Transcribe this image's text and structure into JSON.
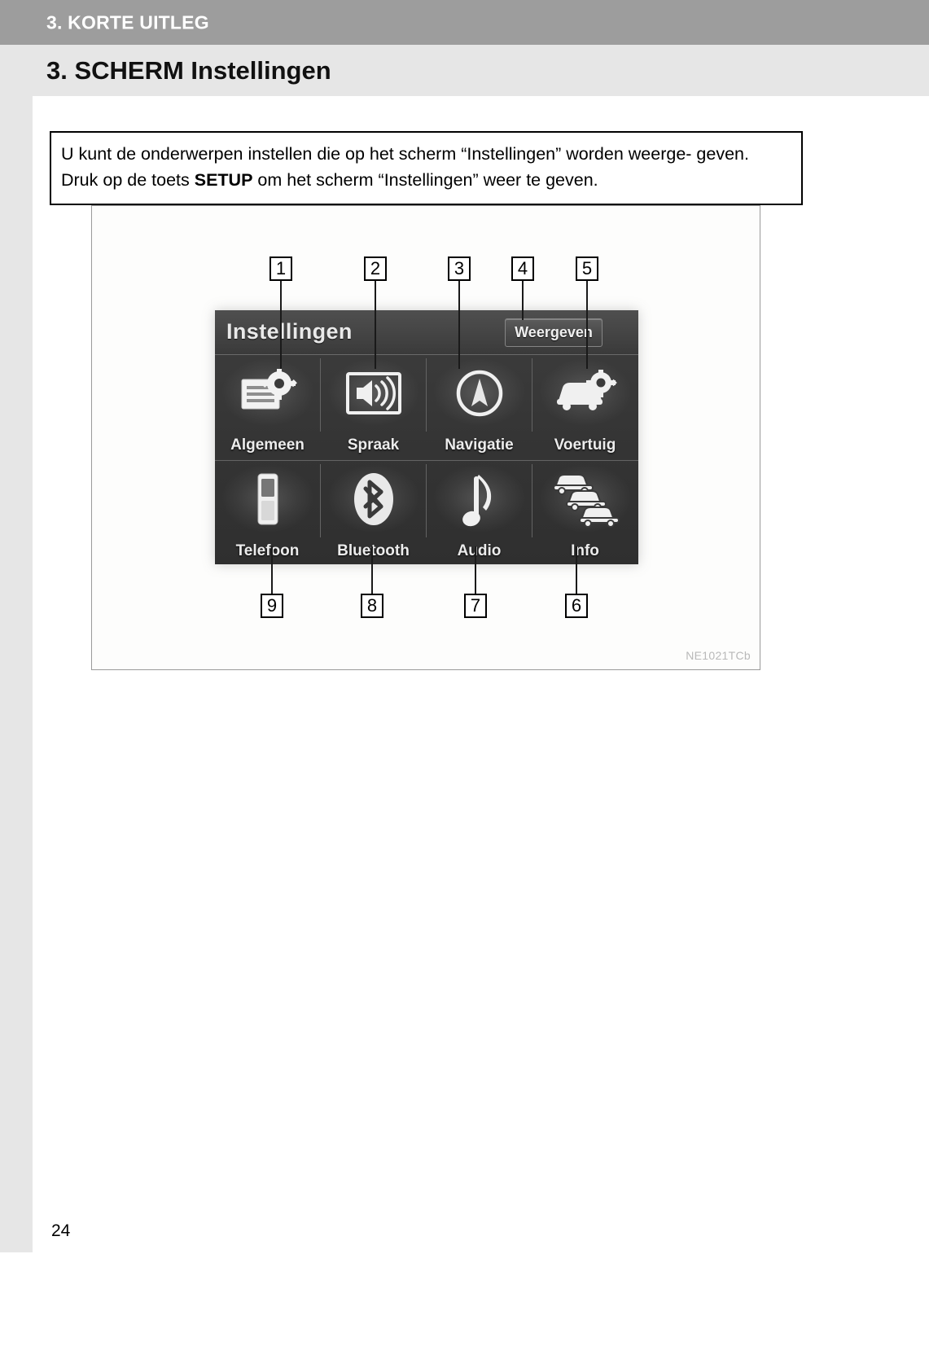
{
  "chapter": {
    "label": "3. KORTE UITLEG"
  },
  "section": {
    "title": "3. SCHERM Instellingen"
  },
  "intro": {
    "line1_before": "U kunt de onderwerpen instellen die op het scherm “Instellingen” worden weerge-",
    "line2_a": "geven. Druk op de toets ",
    "line2_key": "SETUP",
    "line2_b": " om het scherm “Instellingen” weer te geven."
  },
  "figure": {
    "code": "NE1021TCb",
    "screen": {
      "title": "Instellingen",
      "display_button": "Weergeven",
      "items": [
        {
          "label": "Algemeen",
          "icon": "general-settings-icon",
          "callout": "1"
        },
        {
          "label": "Spraak",
          "icon": "voice-speaker-icon",
          "callout": "2"
        },
        {
          "label": "Navigatie",
          "icon": "navigation-compass-icon",
          "callout": "3"
        },
        {
          "label": "Voertuig",
          "icon": "vehicle-settings-icon",
          "callout": "5"
        },
        {
          "label": "Telefoon",
          "icon": "phone-icon",
          "callout": "9"
        },
        {
          "label": "Bluetooth",
          "icon": "bluetooth-icon",
          "callout": "8"
        },
        {
          "label": "Audio",
          "icon": "music-note-icon",
          "callout": "7"
        },
        {
          "label": "Info",
          "icon": "traffic-cars-icon",
          "callout": "6"
        }
      ]
    },
    "callouts_top": [
      "1",
      "2",
      "3",
      "4",
      "5"
    ],
    "callouts_bottom": [
      "9",
      "8",
      "7",
      "6"
    ]
  },
  "page": {
    "number": "24"
  },
  "colors": {
    "chapter_bar": "#9d9d9d",
    "title_band": "#e6e6e6",
    "screen_dark": "#343434",
    "text": "#000000"
  }
}
